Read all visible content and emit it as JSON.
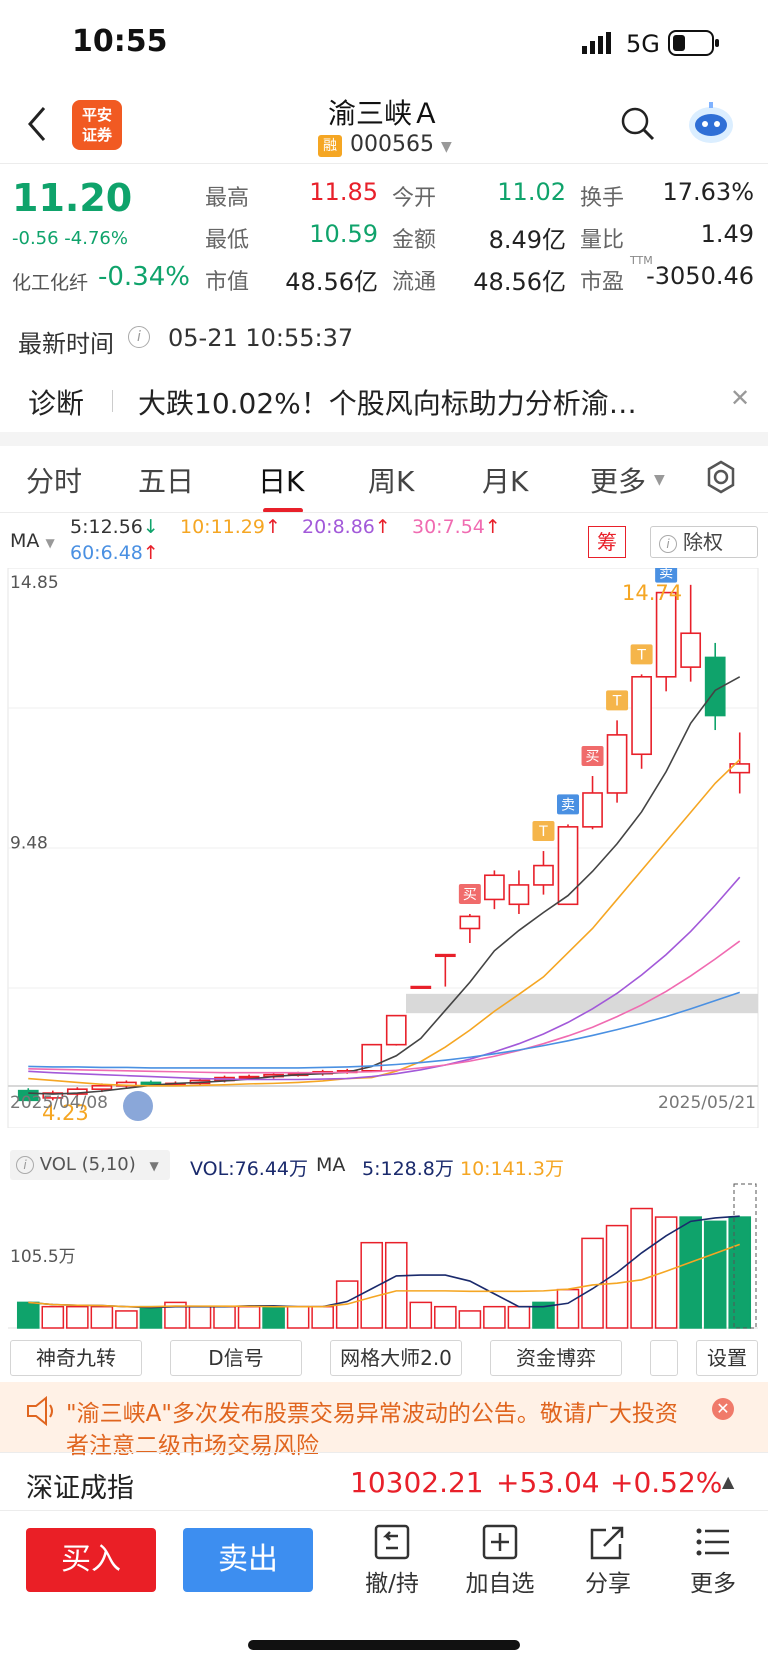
{
  "status": {
    "time": "10:55",
    "network": "5G"
  },
  "header": {
    "logo_line1": "平安",
    "logo_line2": "证券",
    "title": "渝三峡Ａ",
    "rong": "融",
    "code": "000565"
  },
  "quote": {
    "price": "11.20",
    "change": "-0.56  -4.76%",
    "sector_name": "化工化纤",
    "sector_change": "-0.34%",
    "cells": [
      {
        "label": "最高",
        "value": "11.85",
        "color": "#e8202a"
      },
      {
        "label": "今开",
        "value": "11.02",
        "color": "#0fa36b"
      },
      {
        "label": "换手",
        "value": "17.63%",
        "color": "#222222"
      },
      {
        "label": "最低",
        "value": "10.59",
        "color": "#0fa36b"
      },
      {
        "label": "金额",
        "value": "8.49亿",
        "color": "#222222"
      },
      {
        "label": "量比",
        "value": "1.49",
        "color": "#222222"
      },
      {
        "label": "市值",
        "value": "48.56亿",
        "color": "#222222"
      },
      {
        "label": "流通",
        "value": "48.56亿",
        "color": "#222222"
      },
      {
        "label": "市盈",
        "value": "-3050.46",
        "color": "#222222"
      }
    ],
    "ttm": "TTM"
  },
  "latest": {
    "label": "最新时间",
    "value": "05-21 10:55:37"
  },
  "diagnosis": {
    "label": "诊断",
    "text": "大跌10.02%！个股风向标助力分析渝…"
  },
  "tabs": [
    "分时",
    "五日",
    "日K",
    "周K",
    "月K",
    "更多"
  ],
  "ma": {
    "label": "MA",
    "items": [
      {
        "text": "5:12.56",
        "arrow": "↓",
        "color": "#333333",
        "arrow_color": "#0fa36b"
      },
      {
        "text": "10:11.29",
        "arrow": "↑",
        "color": "#f5a623",
        "arrow_color": "#e8202a"
      },
      {
        "text": "20:8.86",
        "arrow": "↑",
        "color": "#a259d9",
        "arrow_color": "#e8202a"
      },
      {
        "text": "30:7.54",
        "arrow": "↑",
        "color": "#f06bb1",
        "arrow_color": "#e8202a"
      },
      {
        "text": "60:6.48",
        "arrow": "↑",
        "color": "#4a90e2",
        "arrow_color": "#e8202a"
      }
    ],
    "chou": "筹",
    "chuquan": "除权"
  },
  "kchart": {
    "price_high_label": "14.85",
    "price_mid_label": "9.48",
    "max_marker": "14.74",
    "min_marker": "4.23",
    "date_start": "2025/04/08",
    "date_end": "2025/05/21",
    "candles": [
      {
        "o": 4.45,
        "c": 4.25,
        "h": 4.5,
        "l": 4.23
      },
      {
        "o": 4.3,
        "c": 4.4,
        "h": 4.45,
        "l": 4.25
      },
      {
        "o": 4.38,
        "c": 4.48,
        "h": 4.52,
        "l": 4.33
      },
      {
        "o": 4.48,
        "c": 4.55,
        "h": 4.6,
        "l": 4.42
      },
      {
        "o": 4.55,
        "c": 4.62,
        "h": 4.66,
        "l": 4.5
      },
      {
        "o": 4.62,
        "c": 4.58,
        "h": 4.66,
        "l": 4.54
      },
      {
        "o": 4.58,
        "c": 4.6,
        "h": 4.64,
        "l": 4.54
      },
      {
        "o": 4.6,
        "c": 4.66,
        "h": 4.7,
        "l": 4.56
      },
      {
        "o": 4.66,
        "c": 4.72,
        "h": 4.76,
        "l": 4.62
      },
      {
        "o": 4.72,
        "c": 4.74,
        "h": 4.78,
        "l": 4.68
      },
      {
        "o": 4.74,
        "c": 4.78,
        "h": 4.82,
        "l": 4.7
      },
      {
        "o": 4.78,
        "c": 4.8,
        "h": 4.84,
        "l": 4.74
      },
      {
        "o": 4.8,
        "c": 4.84,
        "h": 4.88,
        "l": 4.76
      },
      {
        "o": 4.84,
        "c": 4.86,
        "h": 4.9,
        "l": 4.8
      },
      {
        "o": 4.86,
        "c": 5.4,
        "h": 5.4,
        "l": 4.84
      },
      {
        "o": 5.4,
        "c": 6.0,
        "h": 6.0,
        "l": 5.38
      },
      {
        "o": 6.6,
        "c": 6.6,
        "h": 6.6,
        "l": 6.6
      },
      {
        "o": 7.26,
        "c": 7.26,
        "h": 7.26,
        "l": 6.6
      },
      {
        "o": 7.8,
        "c": 8.05,
        "h": 8.1,
        "l": 7.5
      },
      {
        "o": 8.4,
        "c": 8.9,
        "h": 9.0,
        "l": 8.2
      },
      {
        "o": 8.3,
        "c": 8.7,
        "h": 9.0,
        "l": 8.1
      },
      {
        "o": 8.7,
        "c": 9.1,
        "h": 9.4,
        "l": 8.5
      },
      {
        "o": 8.3,
        "c": 9.9,
        "h": 9.95,
        "l": 8.3
      },
      {
        "o": 9.9,
        "c": 10.6,
        "h": 10.95,
        "l": 9.85
      },
      {
        "o": 10.6,
        "c": 11.8,
        "h": 12.1,
        "l": 10.4
      },
      {
        "o": 11.4,
        "c": 13.0,
        "h": 13.05,
        "l": 11.1
      },
      {
        "o": 13.0,
        "c": 14.74,
        "h": 14.74,
        "l": 12.7
      },
      {
        "o": 13.2,
        "c": 13.9,
        "h": 14.9,
        "l": 12.9
      },
      {
        "o": 13.4,
        "c": 12.2,
        "h": 13.7,
        "l": 11.9
      },
      {
        "o": 11.02,
        "c": 11.2,
        "h": 11.85,
        "l": 10.59
      }
    ],
    "ma5": [
      4.4,
      4.38,
      4.4,
      4.44,
      4.5,
      4.56,
      4.6,
      4.62,
      4.65,
      4.69,
      4.74,
      4.78,
      4.8,
      4.83,
      4.95,
      5.17,
      5.53,
      6.11,
      6.69,
      7.34,
      7.76,
      8.13,
      8.48,
      8.98,
      9.55,
      10.21,
      11.04,
      12.04,
      12.72,
      13.0
    ],
    "ma10": [
      4.7,
      4.66,
      4.62,
      4.58,
      4.56,
      4.55,
      4.55,
      4.56,
      4.57,
      4.59,
      4.6,
      4.62,
      4.65,
      4.7,
      4.72,
      4.85,
      5.05,
      5.35,
      5.7,
      6.09,
      6.44,
      6.8,
      7.3,
      7.8,
      8.4,
      9.0,
      9.6,
      10.2,
      10.8,
      11.29
    ],
    "ma20": [
      4.85,
      4.82,
      4.8,
      4.78,
      4.76,
      4.74,
      4.72,
      4.7,
      4.69,
      4.68,
      4.68,
      4.68,
      4.69,
      4.7,
      4.74,
      4.8,
      4.88,
      4.98,
      5.1,
      5.25,
      5.42,
      5.62,
      5.86,
      6.14,
      6.46,
      6.84,
      7.26,
      7.74,
      8.28,
      8.86
    ],
    "ma30": [
      4.9,
      4.89,
      4.88,
      4.87,
      4.86,
      4.85,
      4.84,
      4.83,
      4.82,
      4.82,
      4.82,
      4.82,
      4.82,
      4.83,
      4.84,
      4.87,
      4.92,
      4.98,
      5.06,
      5.16,
      5.28,
      5.42,
      5.58,
      5.76,
      5.98,
      6.22,
      6.5,
      6.82,
      7.17,
      7.54
    ],
    "ma60": [
      4.95,
      4.94,
      4.94,
      4.93,
      4.93,
      4.92,
      4.92,
      4.92,
      4.92,
      4.92,
      4.92,
      4.92,
      4.93,
      4.94,
      4.96,
      4.99,
      5.03,
      5.08,
      5.14,
      5.21,
      5.29,
      5.38,
      5.48,
      5.59,
      5.71,
      5.84,
      5.98,
      6.14,
      6.31,
      6.48
    ],
    "signals": [
      {
        "i": 18,
        "text": "买",
        "kind": "buy"
      },
      {
        "i": 21,
        "text": "T",
        "kind": "t"
      },
      {
        "i": 22,
        "text": "卖",
        "kind": "sell"
      },
      {
        "i": 23,
        "text": "买",
        "kind": "buy"
      },
      {
        "i": 24,
        "text": "T",
        "kind": "t"
      },
      {
        "i": 25,
        "text": "T",
        "kind": "t"
      },
      {
        "i": 26,
        "text": "卖",
        "kind": "sell"
      }
    ]
  },
  "vol": {
    "label": "VOL (5,10)",
    "value": "VOL:76.44万",
    "ma_label": "MA",
    "ma5": "5:128.8万",
    "ma10": "10:141.3万",
    "scale_label": "105.5万",
    "bars": [
      6,
      5,
      5,
      5,
      4,
      5,
      6,
      5,
      5,
      5,
      5,
      5,
      5,
      11,
      20,
      20,
      6,
      5,
      4,
      5,
      5,
      6,
      9,
      21,
      24,
      28,
      26,
      26,
      25,
      26
    ],
    "bar_up": [
      0,
      1,
      1,
      1,
      1,
      0,
      1,
      1,
      1,
      1,
      0,
      1,
      1,
      1,
      1,
      1,
      1,
      1,
      1,
      1,
      1,
      0,
      1,
      1,
      1,
      1,
      1,
      0,
      0,
      0
    ],
    "note": "bars are relative heights"
  },
  "tools": [
    "神奇九转",
    "D信号",
    "网格大师2.0",
    "资金博弈",
    "",
    "设置"
  ],
  "notice": {
    "text": "\"渝三峡A\"多次发布股票交易异常波动的公告。敬请广大投资者注意二级市场交易风险"
  },
  "index": {
    "name": "深证成指",
    "value": "10302.21",
    "change": "+53.04",
    "pct": "+0.52%"
  },
  "bottom": {
    "buy": "买入",
    "sell": "卖出",
    "actions": [
      "撤/持",
      "加自选",
      "分享",
      "更多"
    ]
  }
}
